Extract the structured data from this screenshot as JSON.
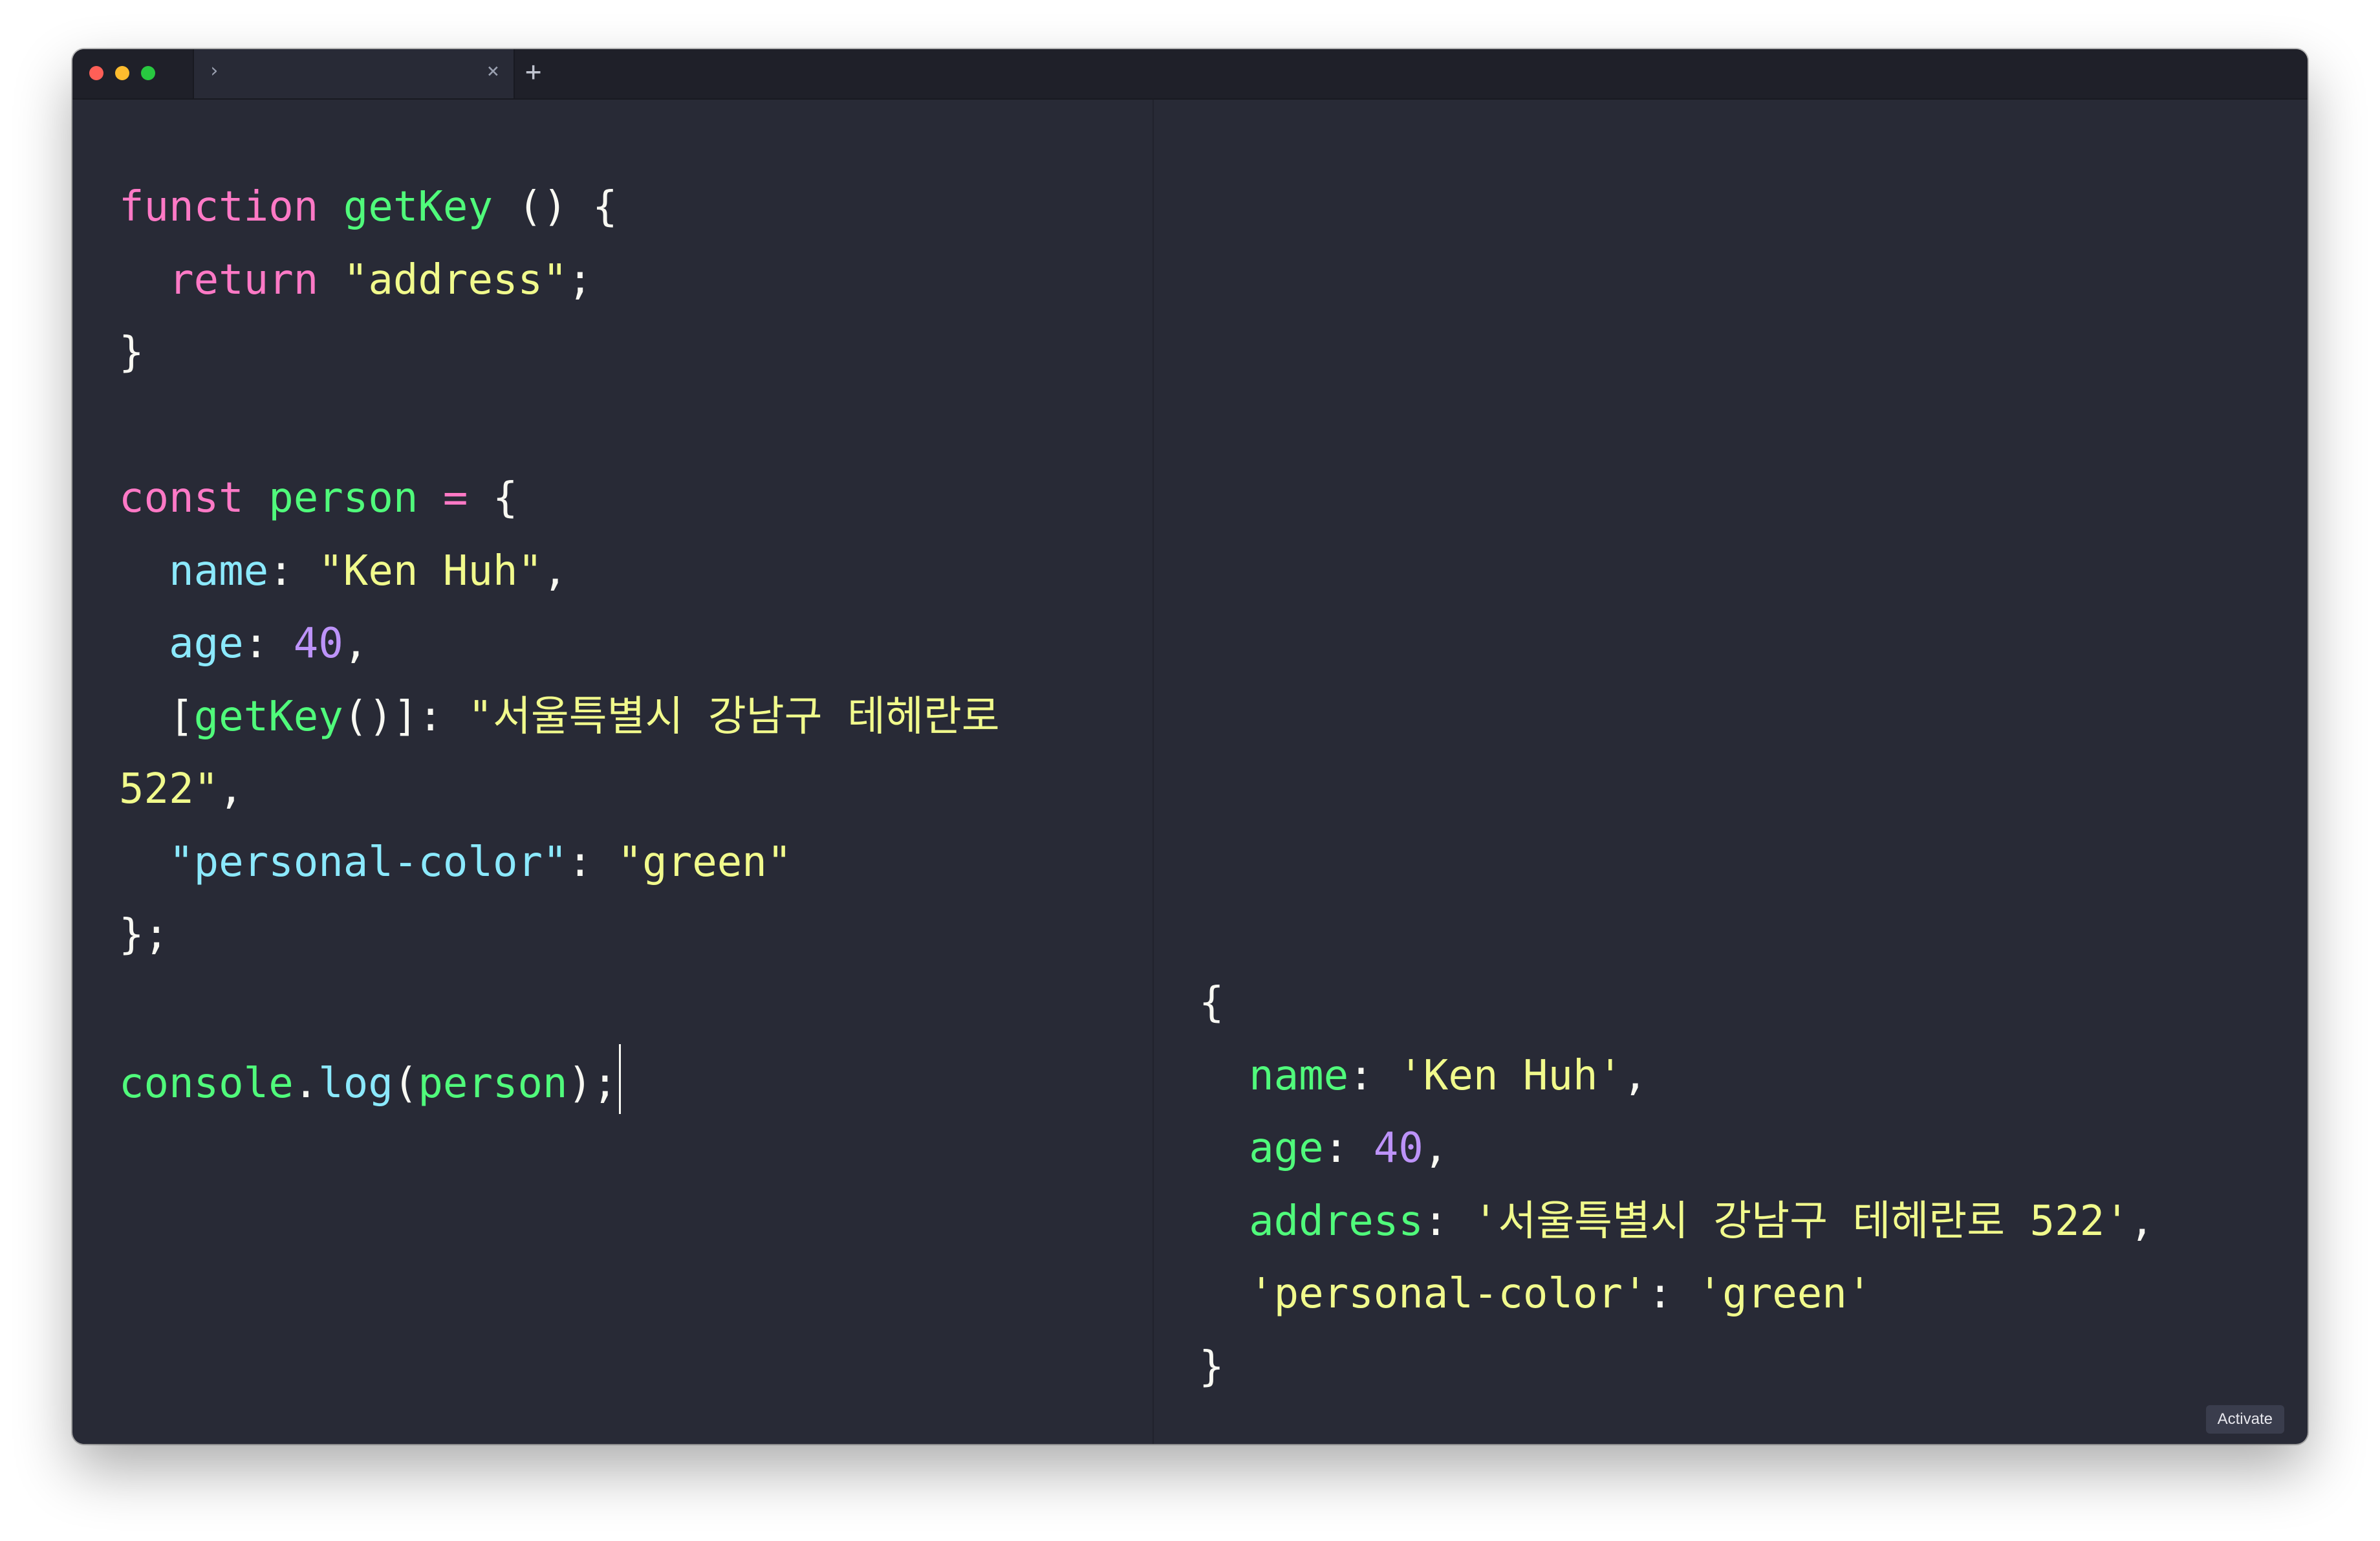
{
  "window": {
    "tab_chevron": "›",
    "tab_close": "×",
    "new_tab": "+"
  },
  "editor": {
    "lines": [
      [
        {
          "t": "function",
          "c": "kw"
        },
        {
          "t": " ",
          "c": "pl"
        },
        {
          "t": "getKey",
          "c": "fn"
        },
        {
          "t": " () {",
          "c": "pl"
        }
      ],
      [
        {
          "t": "  ",
          "c": "pl"
        },
        {
          "t": "return",
          "c": "kw"
        },
        {
          "t": " ",
          "c": "pl"
        },
        {
          "t": "\"address\"",
          "c": "str"
        },
        {
          "t": ";",
          "c": "pl"
        }
      ],
      [
        {
          "t": "}",
          "c": "pl"
        }
      ],
      [],
      [
        {
          "t": "const",
          "c": "kw"
        },
        {
          "t": " ",
          "c": "pl"
        },
        {
          "t": "person",
          "c": "fn"
        },
        {
          "t": " ",
          "c": "pl"
        },
        {
          "t": "=",
          "c": "op"
        },
        {
          "t": " {",
          "c": "pl"
        }
      ],
      [
        {
          "t": "  ",
          "c": "pl"
        },
        {
          "t": "name",
          "c": "prop"
        },
        {
          "t": ": ",
          "c": "pl"
        },
        {
          "t": "\"Ken Huh\"",
          "c": "str"
        },
        {
          "t": ",",
          "c": "pl"
        }
      ],
      [
        {
          "t": "  ",
          "c": "pl"
        },
        {
          "t": "age",
          "c": "prop"
        },
        {
          "t": ": ",
          "c": "pl"
        },
        {
          "t": "40",
          "c": "num"
        },
        {
          "t": ",",
          "c": "pl"
        }
      ],
      [
        {
          "t": "  [",
          "c": "pl"
        },
        {
          "t": "getKey",
          "c": "fn"
        },
        {
          "t": "()]: ",
          "c": "pl"
        },
        {
          "t": "\"서울특별시 강남구 테헤란로",
          "c": "str"
        }
      ],
      [
        {
          "t": "522\"",
          "c": "str"
        },
        {
          "t": ",",
          "c": "pl"
        }
      ],
      [
        {
          "t": "  ",
          "c": "pl"
        },
        {
          "t": "\"personal-color\"",
          "c": "prop"
        },
        {
          "t": ": ",
          "c": "pl"
        },
        {
          "t": "\"green\"",
          "c": "str"
        }
      ],
      [
        {
          "t": "};",
          "c": "pl"
        }
      ],
      [],
      [
        {
          "t": "console",
          "c": "fn"
        },
        {
          "t": ".",
          "c": "pl"
        },
        {
          "t": "log",
          "c": "prop"
        },
        {
          "t": "(",
          "c": "pl"
        },
        {
          "t": "person",
          "c": "fn"
        },
        {
          "t": ");",
          "c": "pl"
        }
      ]
    ],
    "caret_line": 12
  },
  "output": {
    "lines": [
      [
        {
          "t": "{",
          "c": "pl"
        }
      ],
      [
        {
          "t": "  ",
          "c": "pl"
        },
        {
          "t": "name",
          "c": "fn"
        },
        {
          "t": ": ",
          "c": "pl"
        },
        {
          "t": "'Ken Huh'",
          "c": "str"
        },
        {
          "t": ",",
          "c": "pl"
        }
      ],
      [
        {
          "t": "  ",
          "c": "pl"
        },
        {
          "t": "age",
          "c": "fn"
        },
        {
          "t": ": ",
          "c": "pl"
        },
        {
          "t": "40",
          "c": "num"
        },
        {
          "t": ",",
          "c": "pl"
        }
      ],
      [
        {
          "t": "  ",
          "c": "pl"
        },
        {
          "t": "address",
          "c": "fn"
        },
        {
          "t": ": ",
          "c": "pl"
        },
        {
          "t": "'서울특별시 강남구 테헤란로 522'",
          "c": "str"
        },
        {
          "t": ",",
          "c": "pl"
        }
      ],
      [
        {
          "t": "  ",
          "c": "pl"
        },
        {
          "t": "'personal-color'",
          "c": "str"
        },
        {
          "t": ": ",
          "c": "pl"
        },
        {
          "t": "'green'",
          "c": "str"
        }
      ],
      [
        {
          "t": "}",
          "c": "pl"
        }
      ]
    ]
  },
  "activate_label": "Activate",
  "colors": {
    "background": "#282a36",
    "keyword": "#ff79c6",
    "function": "#50fa7b",
    "string": "#f1fa8c",
    "property": "#8be9fd",
    "number": "#bd93f9"
  }
}
